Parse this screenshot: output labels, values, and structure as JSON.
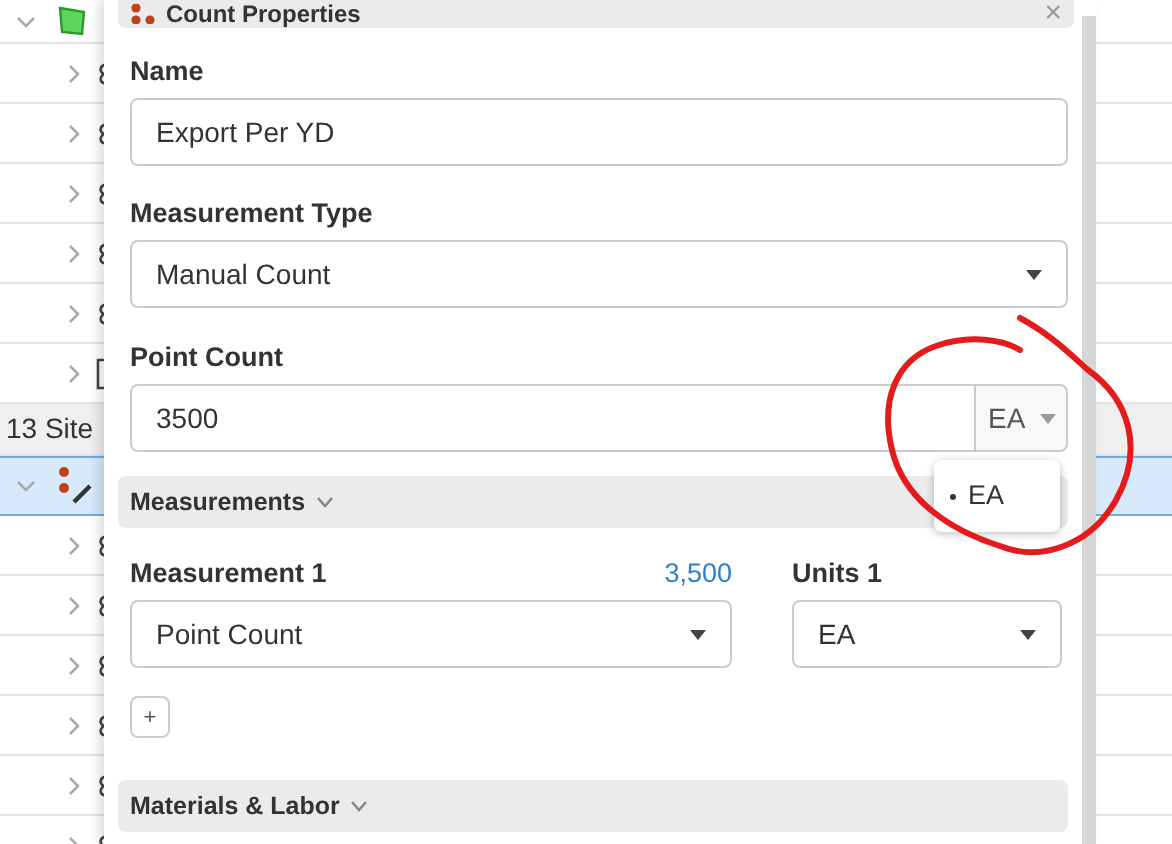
{
  "tree": {
    "rows": [
      {
        "kind": "area",
        "expanded": true,
        "selected": false
      },
      {
        "kind": "item",
        "expanded": false,
        "selected": false
      },
      {
        "kind": "item",
        "expanded": false,
        "selected": false
      },
      {
        "kind": "item",
        "expanded": false,
        "selected": false
      },
      {
        "kind": "item",
        "expanded": false,
        "selected": false
      },
      {
        "kind": "item",
        "expanded": false,
        "selected": false
      },
      {
        "kind": "doc",
        "expanded": false,
        "selected": false
      },
      {
        "kind": "group",
        "label": "13 Site",
        "selected": false
      },
      {
        "kind": "count",
        "expanded": true,
        "selected": true
      },
      {
        "kind": "item",
        "expanded": false,
        "selected": false
      },
      {
        "kind": "item",
        "expanded": false,
        "selected": false
      },
      {
        "kind": "item",
        "expanded": false,
        "selected": false
      },
      {
        "kind": "item",
        "expanded": false,
        "selected": false
      },
      {
        "kind": "item",
        "expanded": false,
        "selected": false
      },
      {
        "kind": "item",
        "expanded": false,
        "selected": false
      }
    ]
  },
  "panel": {
    "title": "Count Properties",
    "close": "×",
    "name": {
      "label": "Name",
      "value": "Export Per YD"
    },
    "measurement_type": {
      "label": "Measurement Type",
      "value": "Manual Count"
    },
    "point_count": {
      "label": "Point Count",
      "value": "3500",
      "unit": "EA",
      "unit_menu": [
        {
          "label": "EA",
          "selected": true
        }
      ]
    },
    "sections": [
      {
        "title": "Measurements",
        "expanded": true
      },
      {
        "title": "Materials & Labor",
        "expanded": true
      }
    ],
    "measurements": [
      {
        "label": "Measurement 1",
        "total": "3,500",
        "value": "Point Count",
        "units_label": "Units 1",
        "units": "EA"
      }
    ],
    "add_button": "+"
  }
}
